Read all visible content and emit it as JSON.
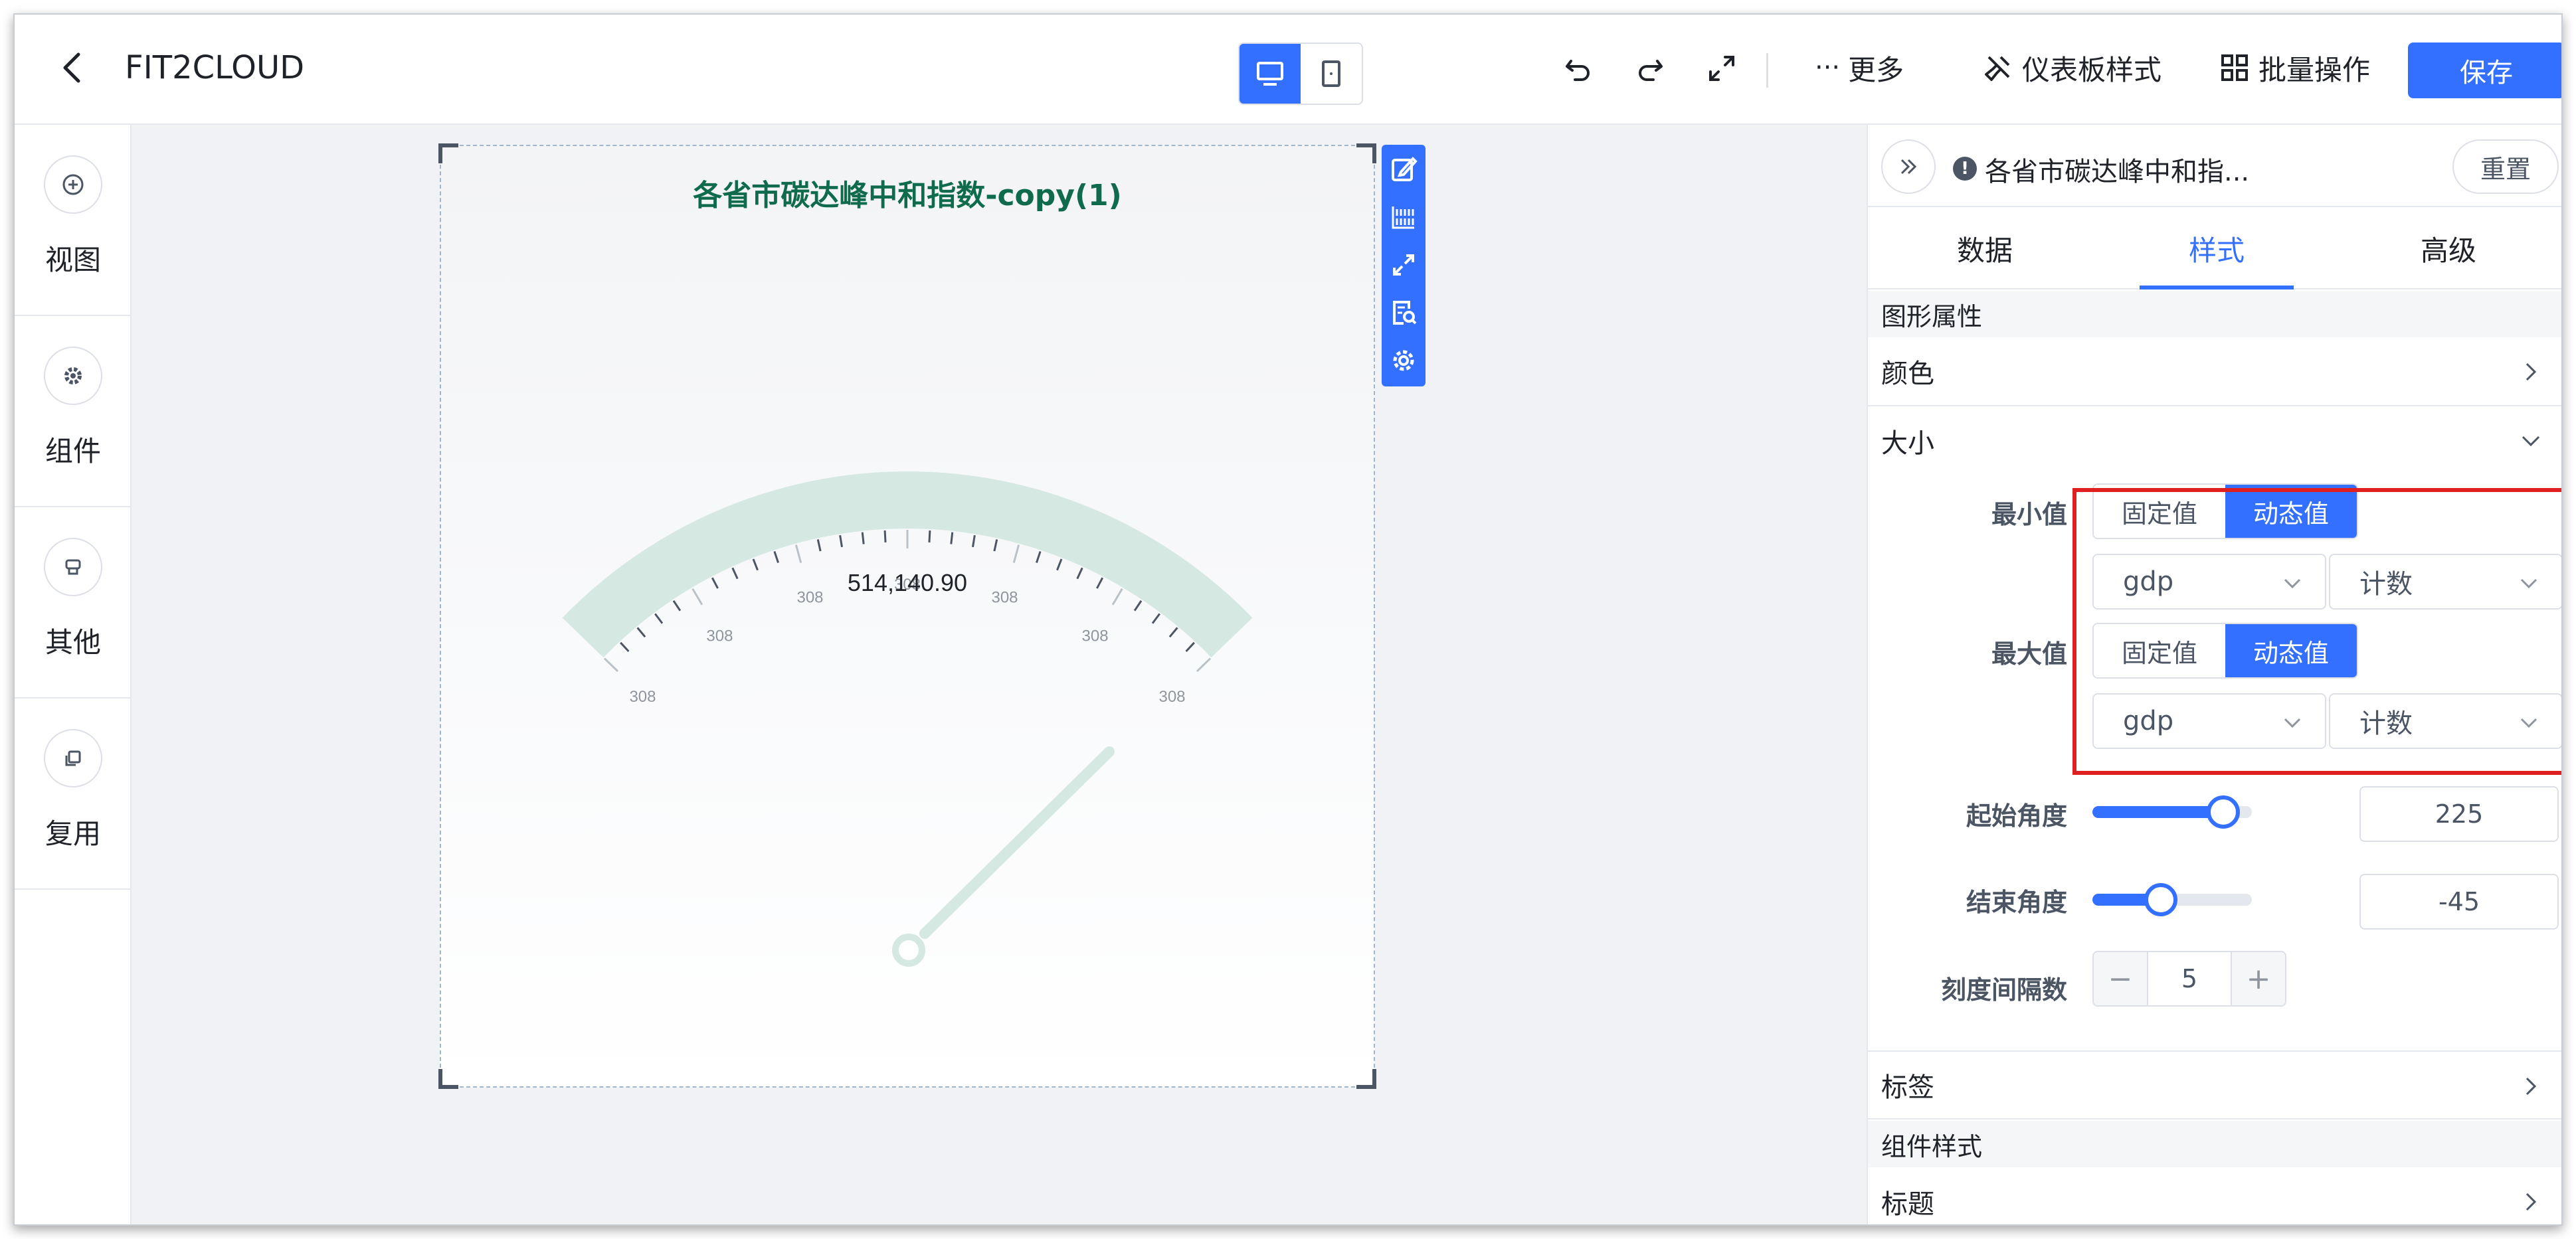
{
  "header": {
    "title": "FIT2CLOUD",
    "more_label": "更多",
    "dashboard_style_label": "仪表板样式",
    "batch_label": "批量操作",
    "save_label": "保存"
  },
  "sidebar": {
    "items": [
      {
        "label": "视图",
        "icon": "plus-circle-icon"
      },
      {
        "label": "组件",
        "icon": "gear-icon"
      },
      {
        "label": "其他",
        "icon": "stamp-icon"
      },
      {
        "label": "复用",
        "icon": "copy-icon"
      }
    ]
  },
  "chart": {
    "title": "各省市碳达峰中和指数-copy(1)",
    "value_label": "514,140.90"
  },
  "chart_data": {
    "type": "gauge",
    "title": "各省市碳达峰中和指数-copy(1)",
    "value": 514140.9,
    "value_label": "514,140.90",
    "tick_labels": [
      "308",
      "308",
      "308",
      "308",
      "308",
      "308",
      "308"
    ],
    "start_angle": 225,
    "end_angle": -45,
    "colors": {
      "arc": "#d5e8e1",
      "pointer": "#d5e8e1",
      "title": "#0f6b4b"
    }
  },
  "panel": {
    "chart_name": "各省市碳达峰中和指...",
    "reset_label": "重置",
    "tabs": [
      "数据",
      "样式",
      "高级"
    ],
    "active_tab": "样式",
    "section_graphic": "图形属性",
    "color_label": "颜色",
    "size_label": "大小",
    "min": {
      "label": "最小值",
      "fixed": "固定值",
      "dynamic": "动态值",
      "field": "gdp",
      "agg": "计数"
    },
    "max": {
      "label": "最大值",
      "fixed": "固定值",
      "dynamic": "动态值",
      "field": "gdp",
      "agg": "计数"
    },
    "start_angle": {
      "label": "起始角度",
      "value": "225",
      "slider_fraction": 0.82
    },
    "end_angle": {
      "label": "结束角度",
      "value": "-45",
      "slider_fraction": 0.43
    },
    "tick_interval": {
      "label": "刻度间隔数",
      "value": "5",
      "minus": "−",
      "plus": "+"
    },
    "label_row": "标签",
    "section_component": "组件样式",
    "title_row": "标题"
  },
  "colors": {
    "accent": "#3370ff",
    "highlight": "#e02020"
  }
}
